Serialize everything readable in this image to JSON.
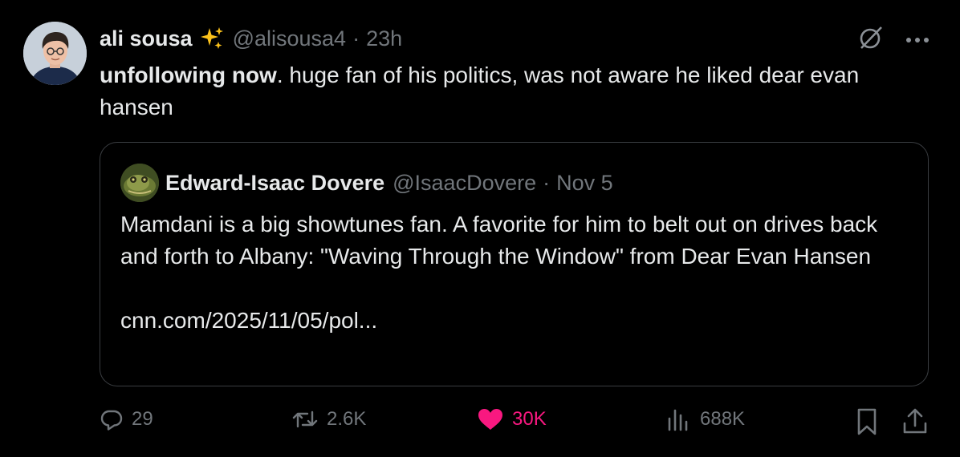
{
  "tweet": {
    "author_name": "ali sousa",
    "author_handle": "@alisousa4",
    "separator": "·",
    "time": "23h",
    "text_bold": "unfollowing now",
    "text_rest": ". huge fan of his politics, was not aware he liked dear evan hansen"
  },
  "quote": {
    "author_name": "Edward-Isaac Dovere",
    "author_handle": "@IsaacDovere",
    "separator": "·",
    "date": "Nov 5",
    "text": "Mamdani is a big showtunes fan. A favorite for him to belt out on drives back and forth to Albany: \"Waving Through the Window\" from Dear Evan Hansen\n\ncnn.com/2025/11/05/pol..."
  },
  "actions": {
    "replies": "29",
    "reposts": "2.6K",
    "likes": "30K",
    "views": "688K",
    "liked": true
  },
  "colors": {
    "background": "#000000",
    "text": "#e7e9ea",
    "muted": "#71767b",
    "like": "#f91880",
    "border": "#3a3d41"
  },
  "icons": [
    "sparkles-emoji",
    "grok-icon",
    "more-icon",
    "reply-icon",
    "repost-icon",
    "heart-icon",
    "views-icon",
    "bookmark-icon",
    "share-icon"
  ]
}
